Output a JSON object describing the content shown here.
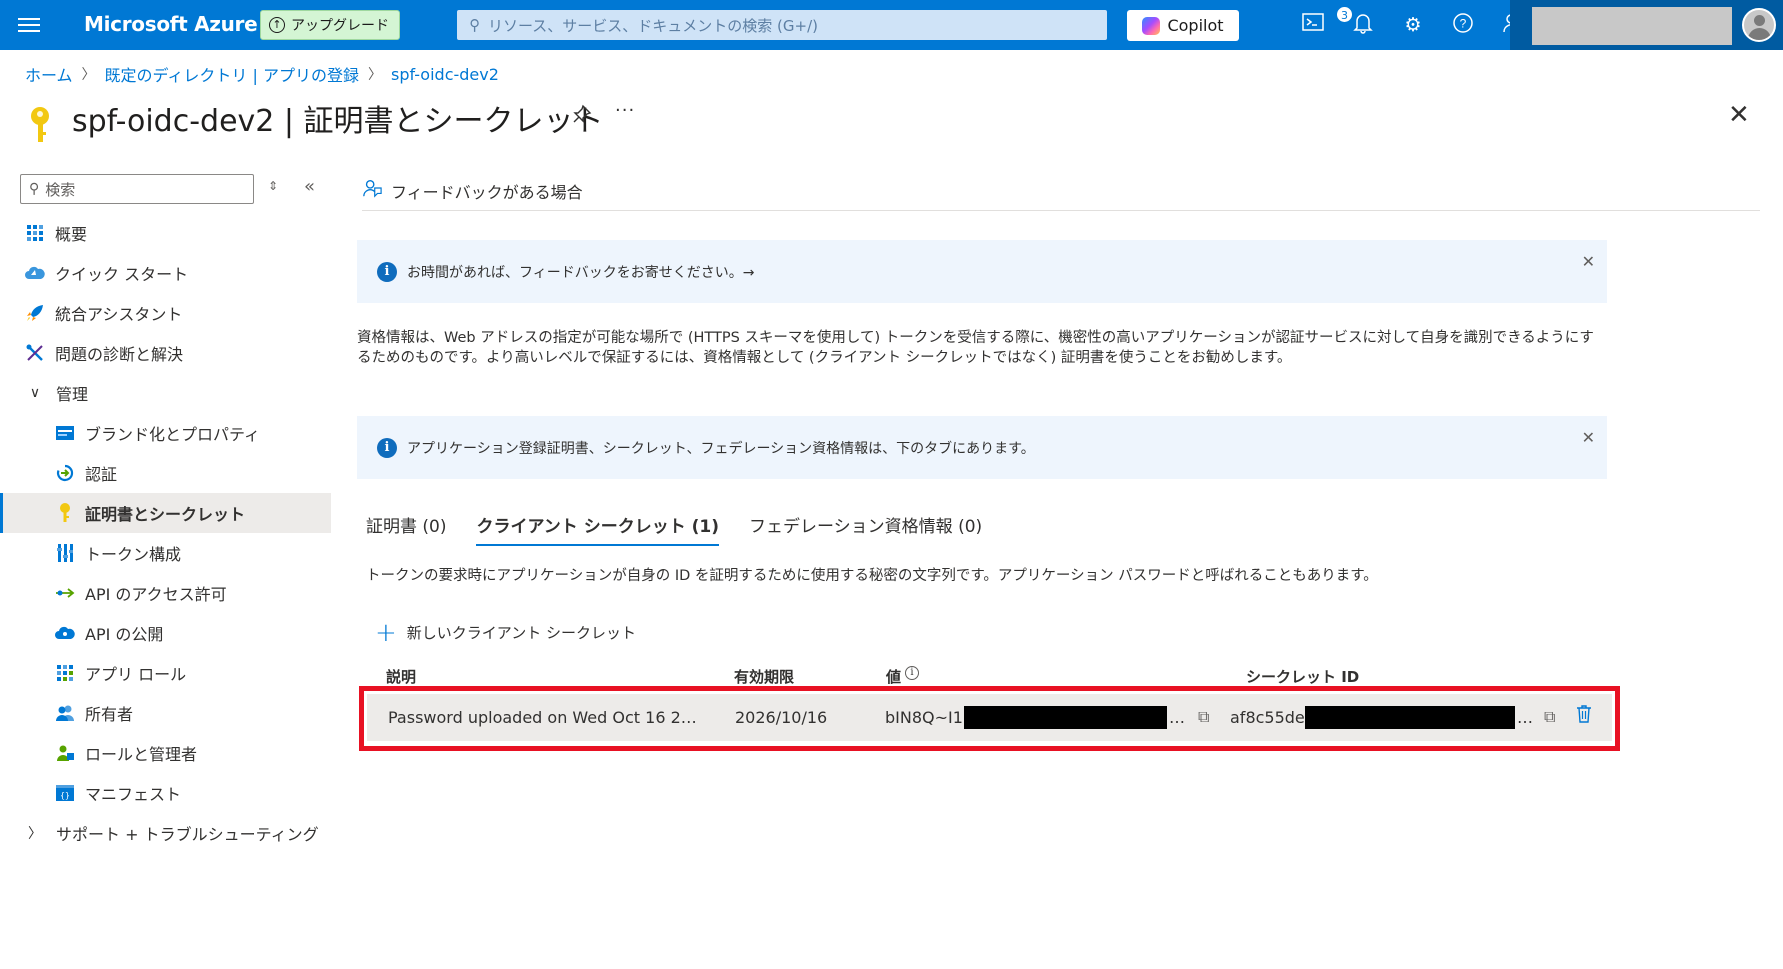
{
  "topbar": {
    "brand": "Microsoft Azure",
    "upgrade_label": "アップグレード",
    "search_placeholder": "リソース、サービス、ドキュメントの検索 (G+/)",
    "copilot_label": "Copilot",
    "notification_count": "3",
    "accent_color": "#0078d4"
  },
  "breadcrumb": [
    "ホーム",
    "既定のディレクトリ | アプリの登録",
    "spf-oidc-dev2"
  ],
  "page": {
    "title": "spf-oidc-dev2 | 証明書とシークレット",
    "more_label": "···",
    "close_label": "✕"
  },
  "sidebar": {
    "search_placeholder": "検索",
    "items": [
      {
        "label": "概要",
        "icon": "overview-icon"
      },
      {
        "label": "クイック スタート",
        "icon": "quickstart-icon"
      },
      {
        "label": "統合アシスタント",
        "icon": "rocket-icon"
      },
      {
        "label": "問題の診断と解決",
        "icon": "wrench-icon"
      },
      {
        "label": "管理",
        "icon": "chevron-down-icon"
      },
      {
        "label": "ブランド化とプロパティ",
        "icon": "branding-icon"
      },
      {
        "label": "認証",
        "icon": "auth-icon"
      },
      {
        "label": "証明書とシークレット",
        "icon": "key-icon"
      },
      {
        "label": "トークン構成",
        "icon": "token-icon"
      },
      {
        "label": "API のアクセス許可",
        "icon": "api-permission-icon"
      },
      {
        "label": "API の公開",
        "icon": "cloud-icon"
      },
      {
        "label": "アプリ ロール",
        "icon": "app-roles-icon"
      },
      {
        "label": "所有者",
        "icon": "owners-icon"
      },
      {
        "label": "ロールと管理者",
        "icon": "roles-admins-icon"
      },
      {
        "label": "マニフェスト",
        "icon": "manifest-icon"
      },
      {
        "label": "サポート + トラブルシューティング",
        "icon": "chevron-right-icon"
      }
    ]
  },
  "content": {
    "feedback_label": "フィードバックがある場合",
    "banner1": "お時間があれば、フィードバックをお寄せください。→",
    "description": "資格情報は、Web アドレスの指定が可能な場所で (HTTPS スキーマを使用して) トークンを受信する際に、機密性の高いアプリケーションが認証サービスに対して自身を識別できるようにするためのものです。より高いレベルで保証するには、資格情報として (クライアント シークレットではなく) 証明書を使うことをお勧めします。",
    "banner2": "アプリケーション登録証明書、シークレット、フェデレーション資格情報は、下のタブにあります。",
    "tabs": [
      "証明書 (0)",
      "クライアント シークレット (1)",
      "フェデレーション資格情報 (0)"
    ],
    "tab_description": "トークンの要求時にアプリケーションが自身の ID を証明するために使用する秘密の文字列です。アプリケーション パスワードと呼ばれることもあります。",
    "new_secret_label": "新しいクライアント シークレット",
    "columns": [
      "説明",
      "有効期限",
      "値",
      "シークレット ID"
    ],
    "secret_row": {
      "description": "Password uploaded on Wed Oct 16 2…",
      "expires": "2026/10/16",
      "value_prefix": "bIN8Q~I1",
      "value_suffix": "…",
      "secret_id_prefix": "af8c55de",
      "secret_id_suffix": "…"
    }
  }
}
